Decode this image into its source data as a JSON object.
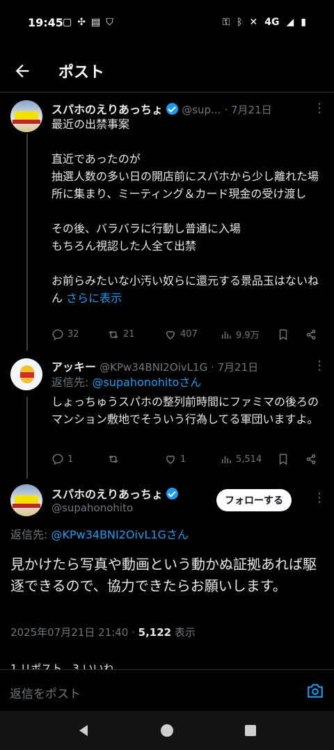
{
  "status_bar": {
    "time": "19:45",
    "network": "4G"
  },
  "header": {
    "title": "ポスト"
  },
  "post1": {
    "name": "スパホのえりあっちょ",
    "handle": "@sup...",
    "date": "· 7月21日",
    "text": "最近の出禁事案\n\n直近であったのが\n抽選人数の多い日の開店前にスパホから少し離れた場所に集まり、ミーティング＆カード現金の受け渡し\n\nその後、バラバラに行動し普通に入場\nもちろん視認した人全て出禁\n\nお前らみたいな小汚い奴らに還元する景品玉はないねん ",
    "show_more": "さらに表示",
    "replies": "32",
    "reposts": "21",
    "likes": "407",
    "views": "9.9万"
  },
  "post2": {
    "name": "アッキー",
    "handle": "@KPw34BNI2OivL1G · 7月21日",
    "reply_to_label": "返信先: ",
    "reply_to_user": "@supahonohitoさん",
    "text": "しょっちゅうスパホの整列前時間にファミマの後ろのマンション敷地でそういう行為してる軍団いますよ。",
    "replies": "1",
    "reposts": "",
    "likes": "1",
    "views": "5,514"
  },
  "post3": {
    "name": "スパホのえりあっちょ",
    "handle": "@supahonohito",
    "follow_label": "フォローする",
    "reply_to_label": "返信先: ",
    "reply_to_user": "@KPw34BNI2OivL1Gさん",
    "text": "見かけたら写真や動画という動かぬ証拠あれば駆逐できるので、協力できたらお願いします。",
    "timestamp": "2025年07月21日 21:40 · ",
    "views_count": "5,122",
    "views_label": " 表示",
    "stats_partial": "1 リポスト　3 いいね"
  },
  "reply_bar": {
    "placeholder": "返信をポスト"
  },
  "colors": {
    "accent": "#1d9bf0",
    "background": "#000000",
    "muted": "#71767b"
  }
}
